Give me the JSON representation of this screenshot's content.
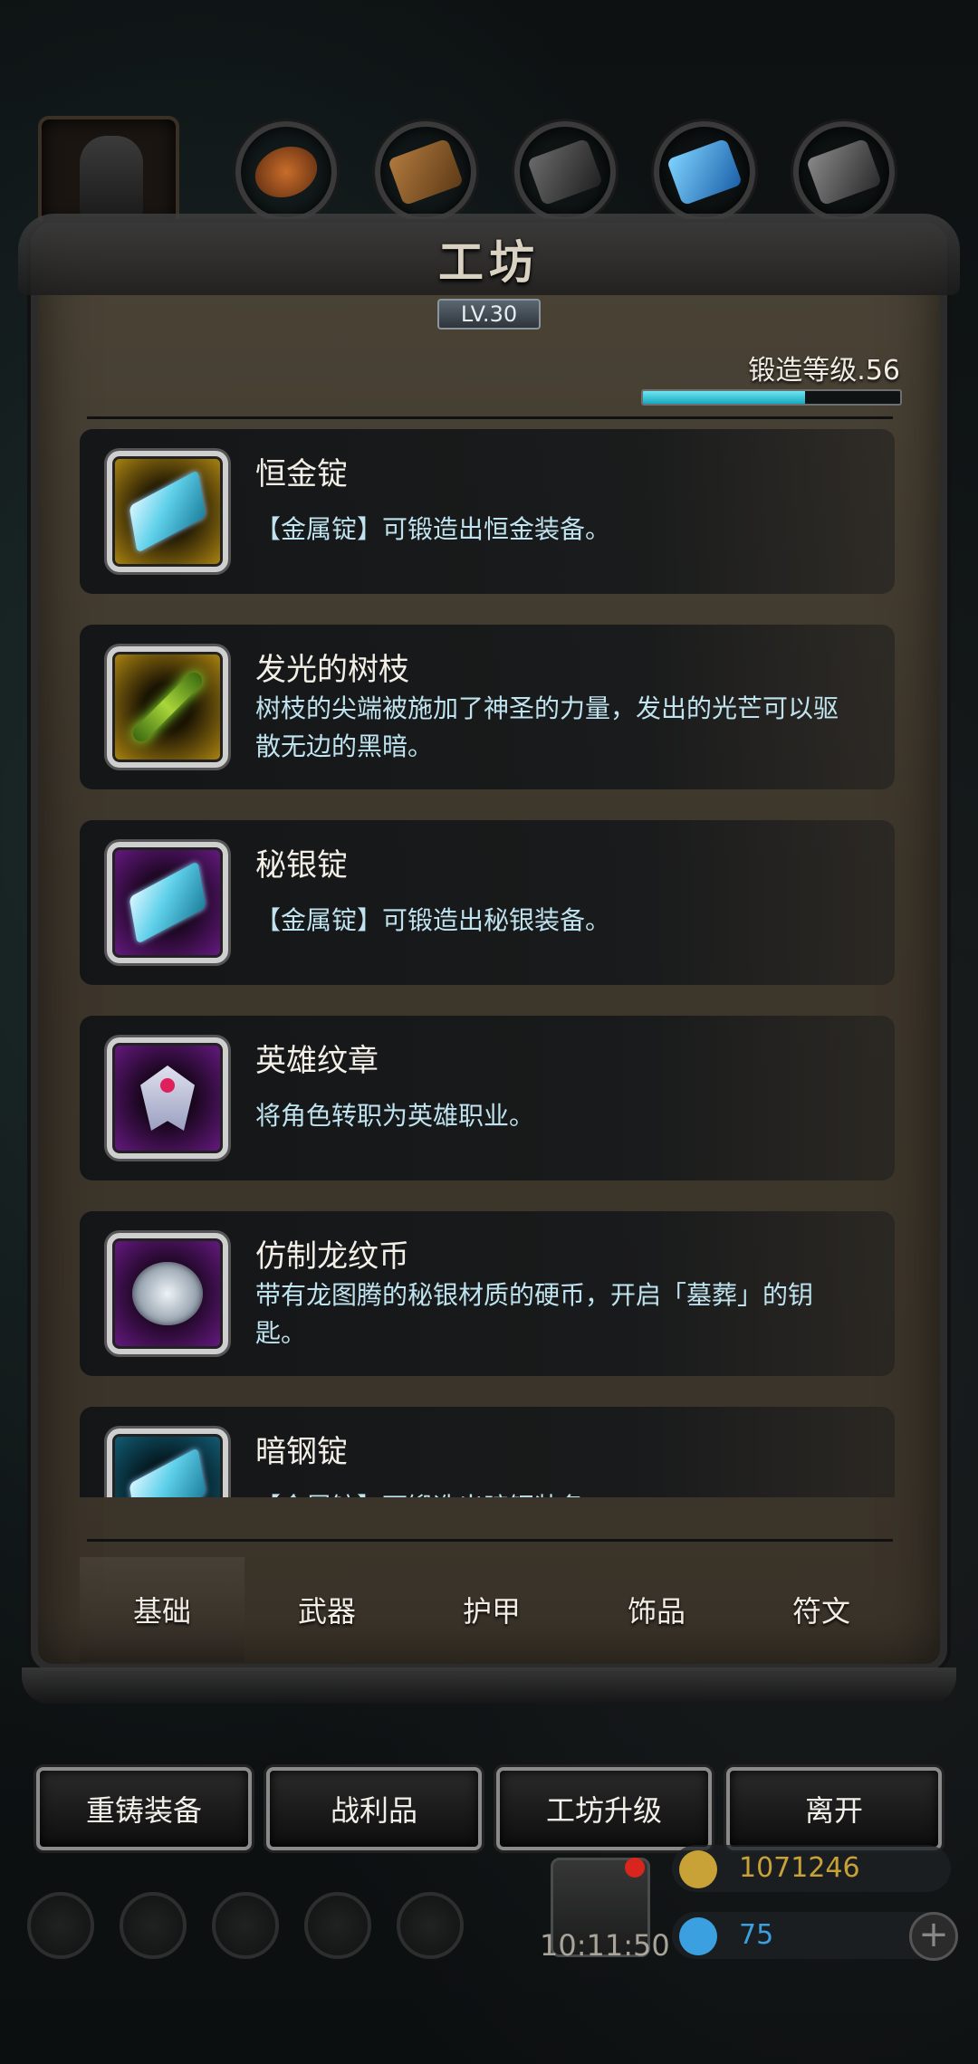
{
  "header": {
    "title": "工坊",
    "level": "LV.30",
    "forge_level_label": "锻造等级.56",
    "forge_progress": 0.63
  },
  "top_tabs": [
    {
      "icon": "hero-helmet-icon"
    },
    {
      "icon": "ore-icon"
    },
    {
      "icon": "wood-icon"
    },
    {
      "icon": "iron-plate-icon"
    },
    {
      "icon": "crystal-icon"
    },
    {
      "icon": "steel-icon"
    }
  ],
  "items": [
    {
      "name": "恒金锭",
      "desc": "【金属锭】可锻造出恒金装备。",
      "frame": "gold",
      "icon": "ingot-icon"
    },
    {
      "name": "发光的树枝",
      "desc": "树枝的尖端被施加了神圣的力量，发出的光芒可以驱散无边的黑暗。",
      "frame": "gold",
      "icon": "glowing-branch-icon"
    },
    {
      "name": "秘银锭",
      "desc": "【金属锭】可锻造出秘银装备。",
      "frame": "purple",
      "icon": "ingot-icon"
    },
    {
      "name": "英雄纹章",
      "desc": "将角色转职为英雄职业。",
      "frame": "purple",
      "icon": "hero-emblem-icon"
    },
    {
      "name": "仿制龙纹币",
      "desc": "带有龙图腾的秘银材质的硬币，开启「墓葬」的钥匙。",
      "frame": "purple",
      "icon": "dragon-coin-icon"
    },
    {
      "name": "暗钢锭",
      "desc": "【金属锭】可锻造出暗钢装备。",
      "frame": "teal",
      "icon": "ingot-icon"
    }
  ],
  "category_tabs": [
    "基础",
    "武器",
    "护甲",
    "饰品",
    "符文"
  ],
  "actions": [
    "重铸装备",
    "战利品",
    "工坊升级",
    "离开"
  ],
  "hud": {
    "timer": "10:11:50",
    "gold": "1071246",
    "gems": "75",
    "colors": {
      "gold": "#c8a236",
      "gems": "#3aa0e0"
    }
  }
}
